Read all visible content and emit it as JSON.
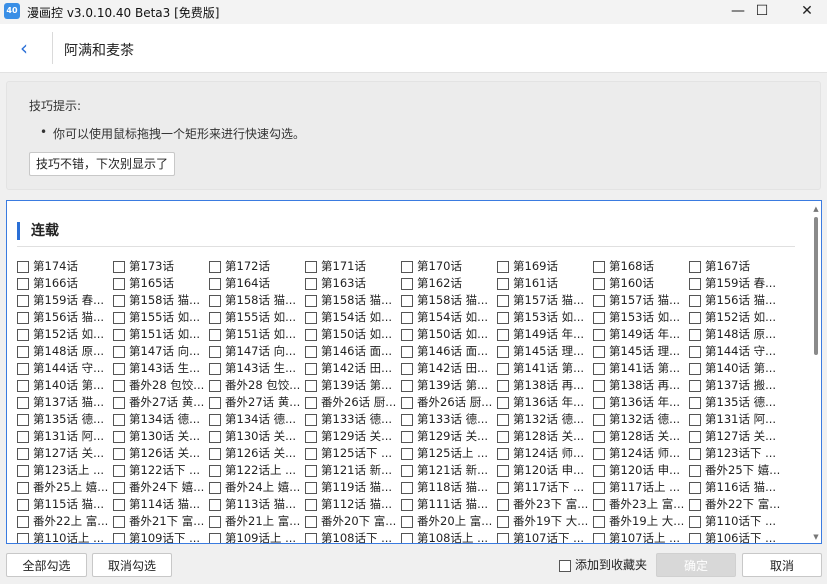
{
  "window": {
    "app_icon_text": "40",
    "title": "漫画控 v3.0.10.40 Beta3 [免费版]",
    "minimize": "—",
    "maximize": "☐",
    "close": "✕"
  },
  "nav": {
    "back_glyph": "‹",
    "title": "阿满和麦茶"
  },
  "tip": {
    "heading": "技巧提示:",
    "item": "你可以使用鼠标拖拽一个矩形来进行快速勾选。",
    "dismiss_label": "技巧不错，下次别显示了"
  },
  "section": {
    "title": "连载"
  },
  "chapters": [
    "第174话",
    "第173话",
    "第172话",
    "第171话",
    "第170话",
    "第169话",
    "第168话",
    "第167话",
    "第166话",
    "第165话",
    "第164话",
    "第163话",
    "第162话",
    "第161话",
    "第160话",
    "第159话 春...",
    "第159话 春...",
    "第158话 猫...",
    "第158话 猫...",
    "第158话 猫...",
    "第158话 猫...",
    "第157话 猫...",
    "第157话 猫...",
    "第156话 猫...",
    "第156话 猫...",
    "第155话 如...",
    "第155话 如...",
    "第154话 如...",
    "第154话 如...",
    "第153话 如...",
    "第153话 如...",
    "第152话 如...",
    "第152话 如...",
    "第151话 如...",
    "第151话 如...",
    "第150话 如...",
    "第150话 如...",
    "第149话 年...",
    "第149话 年...",
    "第148话 原...",
    "第148话 原...",
    "第147话 向...",
    "第147话 向...",
    "第146话 面...",
    "第146话 面...",
    "第145话 理...",
    "第145话 理...",
    "第144话 守...",
    "第144话 守...",
    "第143话 生...",
    "第143话 生...",
    "第142话 田...",
    "第142话 田...",
    "第141话 第...",
    "第141话 第...",
    "第140话 第...",
    "第140话 第...",
    "番外28 包饺...",
    "番外28 包饺...",
    "第139话 第...",
    "第139话 第...",
    "第138话 再...",
    "第138话 再...",
    "第137话 搬...",
    "第137话 猫...",
    "番外27话 黄...",
    "番外27话 黄...",
    "番外26话 厨...",
    "番外26话 厨...",
    "第136话 年...",
    "第136话 年...",
    "第135话 德...",
    "第135话 德...",
    "第134话 德...",
    "第134话 德...",
    "第133话 德...",
    "第133话 德...",
    "第132话 德...",
    "第132话 德...",
    "第131话 阿...",
    "第131话 阿...",
    "第130话 关...",
    "第130话 关...",
    "第129话 关...",
    "第129话 关...",
    "第128话 关...",
    "第128话 关...",
    "第127话 关...",
    "第127话 关...",
    "第126话 关...",
    "第126话 关...",
    "第125话下 ...",
    "第125话上 ...",
    "第124话 师...",
    "第124话 师...",
    "第123话下 ...",
    "第123话上 ...",
    "第122话下 ...",
    "第122话上 ...",
    "第121话 新...",
    "第121话 新...",
    "第120话 申...",
    "第120话 申...",
    "番外25下 嬉...",
    "番外25上 嬉...",
    "番外24下 嬉...",
    "番外24上 嬉...",
    "第119话 猫...",
    "第118话 猫...",
    "第117话下 ...",
    "第117话上 ...",
    "第116话 猫...",
    "第115话 猫...",
    "第114话 猫...",
    "第113话 猫...",
    "第112话 猫...",
    "第111话 猫...",
    "番外23下 富...",
    "番外23上 富...",
    "番外22下 富...",
    "番外22上 富...",
    "番外21下 富...",
    "番外21上 富...",
    "番外20下 富...",
    "番外20上 富...",
    "番外19下 大...",
    "番外19上 大...",
    "第110话下 ...",
    "第110话上 ...",
    "第109话下 ...",
    "第109话上 ...",
    "第108话下 ...",
    "第108话上 ...",
    "第107话下 ...",
    "第107话上 ...",
    "第106话下 ..."
  ],
  "footer": {
    "select_all": "全部勾选",
    "deselect": "取消勾选",
    "add_favorite": "添加到收藏夹",
    "confirm": "确定",
    "cancel": "取消"
  },
  "colors": {
    "accent": "#2a6fd6",
    "panel_border": "#3a7be0"
  }
}
